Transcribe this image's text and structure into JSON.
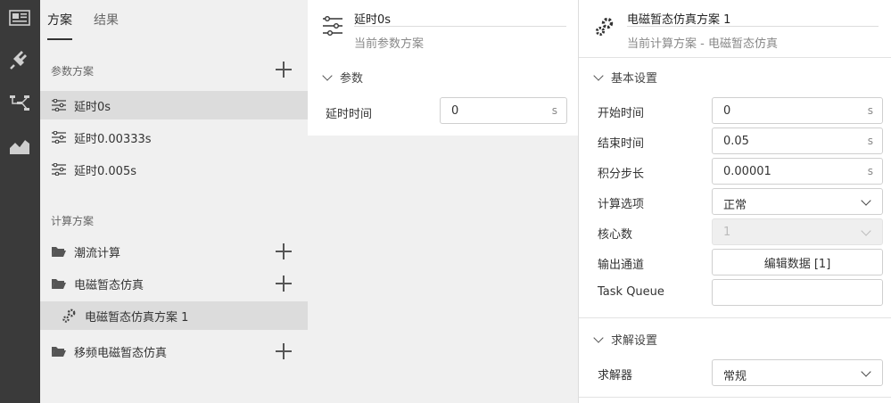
{
  "rail": {
    "icons": [
      "news-icon",
      "plug-icon",
      "diagram-icon",
      "chart-icon"
    ]
  },
  "left": {
    "tabs": [
      {
        "label": "方案"
      },
      {
        "label": "结果"
      }
    ],
    "param_section": "参数方案",
    "param_items": [
      {
        "label": "延时0s"
      },
      {
        "label": "延时0.00333s"
      },
      {
        "label": "延时0.005s"
      }
    ],
    "calc_section": "计算方案",
    "calc_items": [
      {
        "label": "潮流计算"
      },
      {
        "label": "电磁暂态仿真"
      },
      {
        "label": "电磁暂态仿真方案 1"
      },
      {
        "label": "移频电磁暂态仿真"
      }
    ]
  },
  "middle": {
    "title": "延时0s",
    "subtitle": "当前参数方案",
    "group": "参数",
    "field_label": "延时时间",
    "field_value": "0",
    "field_unit": "s"
  },
  "right": {
    "title": "电磁暂态仿真方案 1",
    "subtitle": "当前计算方案 - 电磁暂态仿真",
    "basic_group": "基本设置",
    "fields": {
      "start_label": "开始时间",
      "start_value": "0",
      "start_unit": "s",
      "end_label": "结束时间",
      "end_value": "0.05",
      "end_unit": "s",
      "step_label": "积分步长",
      "step_value": "0.00001",
      "step_unit": "s",
      "calc_opt_label": "计算选项",
      "calc_opt_value": "正常",
      "cores_label": "核心数",
      "cores_value": "1",
      "output_label": "输出通道",
      "output_button": "编辑数据 [1]",
      "task_label": "Task Queue",
      "task_value": ""
    },
    "solve_group": "求解设置",
    "solver_label": "求解器",
    "solver_value": "常规"
  }
}
